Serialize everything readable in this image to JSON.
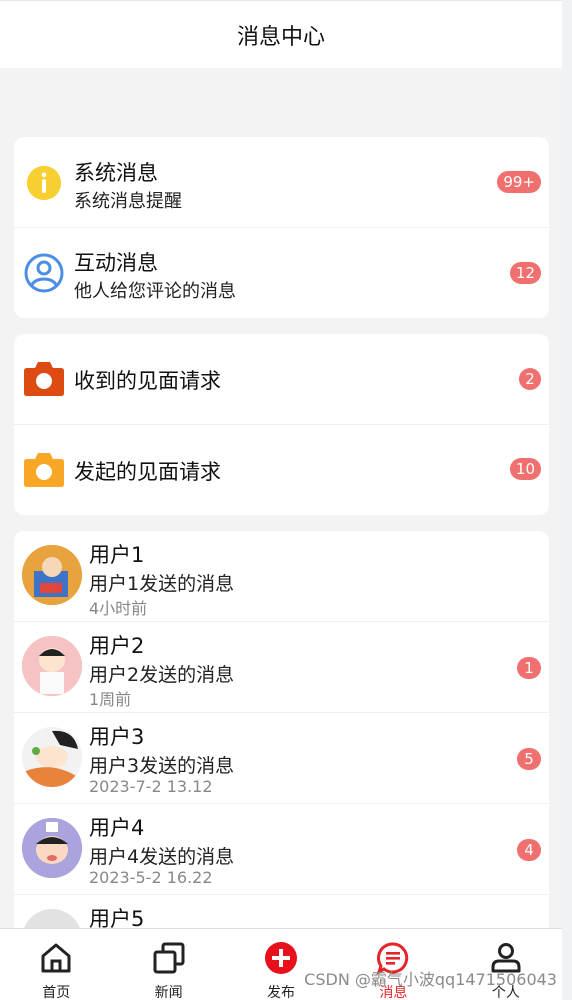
{
  "header": {
    "title": "消息中心"
  },
  "system_card": {
    "items": [
      {
        "title": "系统消息",
        "subtitle": "系统消息提醒",
        "badge": "99+",
        "icon": "info-icon",
        "color": "#f7cf30"
      },
      {
        "title": "互动消息",
        "subtitle": "他人给您评论的消息",
        "badge": "12",
        "icon": "user-circle-icon",
        "color": "#4a8ee6"
      }
    ]
  },
  "meet_card": {
    "items": [
      {
        "title": "收到的见面请求",
        "badge": "2",
        "icon": "camera-icon",
        "color": "#dd4a12"
      },
      {
        "title": "发起的见面请求",
        "badge": "10",
        "icon": "camera-icon",
        "color": "#f7a625"
      }
    ]
  },
  "users": [
    {
      "name": "用户1",
      "message": "用户1发送的消息",
      "time": "4小时前",
      "badge": null
    },
    {
      "name": "用户2",
      "message": "用户2发送的消息",
      "time": "1周前",
      "badge": "1"
    },
    {
      "name": "用户3",
      "message": "用户3发送的消息",
      "time": "2023-7-2 13.12",
      "badge": "5"
    },
    {
      "name": "用户4",
      "message": "用户4发送的消息",
      "time": "2023-5-2 16.22",
      "badge": "4"
    },
    {
      "name": "用户5",
      "message": "",
      "time": "",
      "badge": null
    }
  ],
  "tabbar": {
    "tabs": [
      {
        "label": "首页",
        "icon": "home-icon"
      },
      {
        "label": "新闻",
        "icon": "copy-icon"
      },
      {
        "label": "发布",
        "icon": "plus-circle-icon"
      },
      {
        "label": "消息",
        "icon": "message-icon"
      },
      {
        "label": "个人",
        "icon": "person-icon"
      }
    ],
    "active_color": "#e5252a"
  },
  "watermark": "CSDN @霸气小波qq1471506043",
  "colors": {
    "badge": "#f06f6f",
    "background": "#f3f3f3"
  }
}
